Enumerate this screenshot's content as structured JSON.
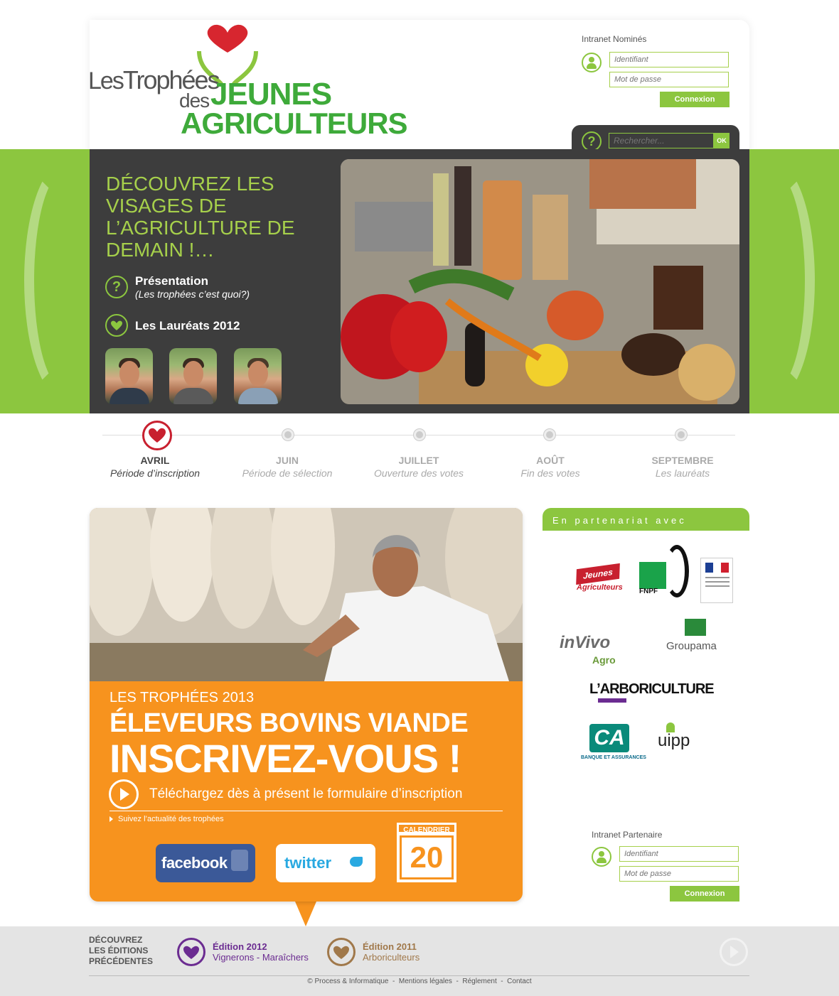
{
  "logo": {
    "les": "Les",
    "trophees": "Trophées",
    "des": "des",
    "jeunes": "JEUNES",
    "agriculteurs": "AGRICULTEURS"
  },
  "login": {
    "title": "Intranet Nominés",
    "id_placeholder": "Identifiant",
    "pwd_placeholder": "Mot de passe",
    "button": "Connexion"
  },
  "search": {
    "placeholder": "Rechercher...",
    "ok": "OK",
    "help_icon": "?"
  },
  "hero": {
    "title": "DÉCOUVREZ LES VISAGES DE L’AGRICULTURE DE DEMAIN !…",
    "presentation": "Présentation",
    "presentation_sub": "(Les trophées c’est quoi?)",
    "laureats": "Les Lauréats 2012"
  },
  "timeline": [
    {
      "month": "AVRIL",
      "desc": "Période d’inscription"
    },
    {
      "month": "JUIN",
      "desc": "Période de sélection"
    },
    {
      "month": "JUILLET",
      "desc": "Ouverture des votes"
    },
    {
      "month": "AOÛT",
      "desc": "Fin des votes"
    },
    {
      "month": "SEPTEMBRE",
      "desc": "Les lauréats"
    }
  ],
  "promo": {
    "year": "LES TROPHÉES 2013",
    "line1": "ÉLEVEURS BOVINS VIANDE",
    "line2": "INSCRIVEZ-VOUS !",
    "download": "Téléchargez dès à présent le formulaire d’inscription",
    "follow": "Suivez l’actualité des trophées",
    "facebook": "facebook",
    "twitter": "twitter",
    "calendar_label": "CALENDRIER",
    "calendar_day": "20"
  },
  "partners": {
    "title": "En partenariat avec",
    "jeunes": "Jeunes",
    "agriculteurs": "Agriculteurs",
    "fnpf": "FNPF",
    "invivo": "inVivo",
    "agro": "Agro",
    "groupama": "Groupama",
    "arbo": "L’ARBORICULTURE",
    "ca": "CA",
    "ca_sub": "BANQUE ET ASSURANCES",
    "uipp": "uipp"
  },
  "intranet_partner": {
    "title": "Intranet Partenaire",
    "id_placeholder": "Identifiant",
    "pwd_placeholder": "Mot de passe",
    "button": "Connexion"
  },
  "footer": {
    "title_1": "DÉCOUVREZ",
    "title_2": "LES ÉDITIONS",
    "title_3": "PRÉCÉDENTES",
    "ed2012_title": "Édition 2012",
    "ed2012_sub": "Vignerons - Maraîchers",
    "ed2011_title": "Édition 2011",
    "ed2011_sub": "Arboriculteurs",
    "links": "© Process & Informatique  -  Mentions légales  -  Réglement  -  Contact"
  },
  "colors": {
    "green": "#8cc63f",
    "dark": "#3d3d3d",
    "orange": "#f7931e",
    "red": "#c8202f",
    "purple": "#6b2c91",
    "brown": "#a0784a"
  }
}
